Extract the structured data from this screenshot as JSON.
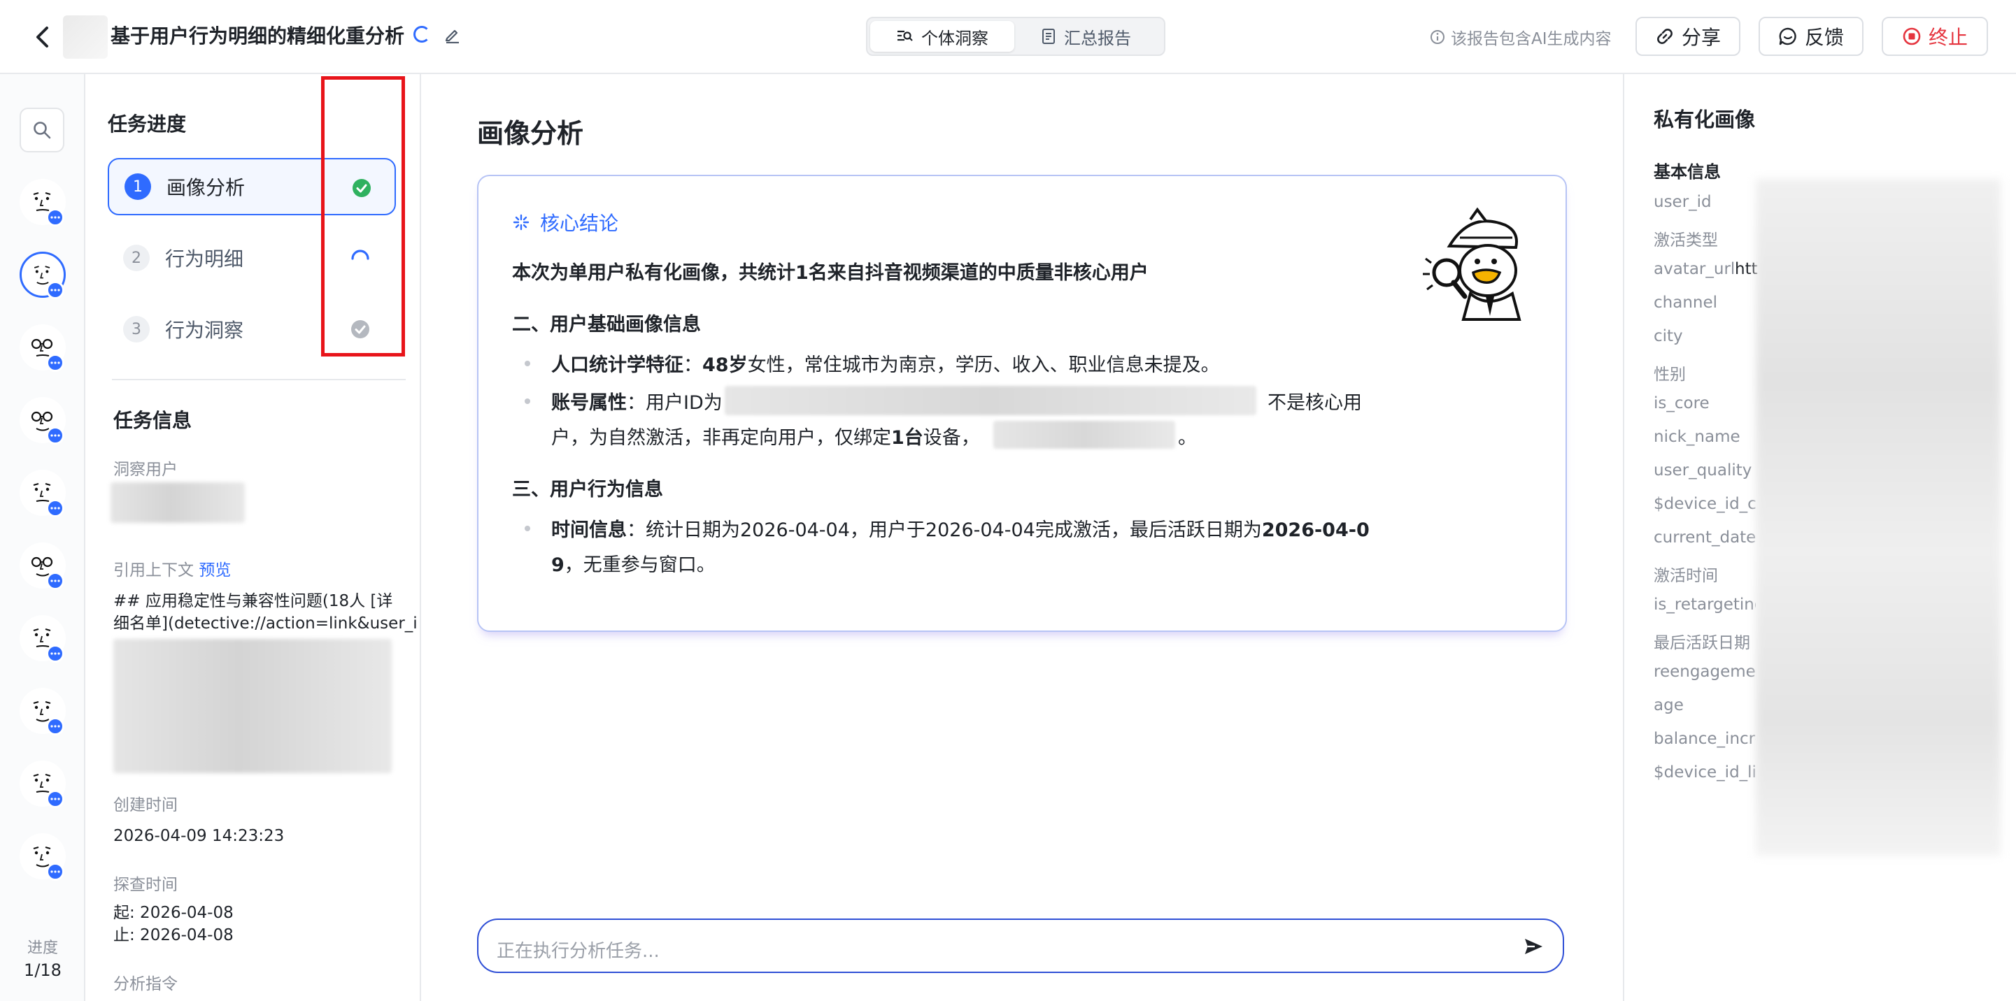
{
  "header": {
    "title": "基于用户行为明细的精细化重分析",
    "tabs": [
      {
        "label": "个体洞察",
        "icon": "insight-icon",
        "active": true
      },
      {
        "label": "汇总报告",
        "icon": "document-icon",
        "active": false
      }
    ],
    "ai_notice": "该报告包含AI生成内容",
    "share_label": "分享",
    "feedback_label": "反馈",
    "stop_label": "终止"
  },
  "rail": {
    "avatar_count": 10,
    "selected_index": 1,
    "progress_label": "进度",
    "progress_value": "1/18"
  },
  "task_panel": {
    "progress_heading": "任务进度",
    "steps": [
      {
        "num": "1",
        "label": "画像分析",
        "status": "completed"
      },
      {
        "num": "2",
        "label": "行为明细",
        "status": "in-progress"
      },
      {
        "num": "3",
        "label": "行为洞察",
        "status": "pending"
      }
    ],
    "info_heading": "任务信息",
    "insight_user_label": "洞察用户",
    "context_label": "引用上下文",
    "context_preview_link": "预览",
    "context_text_1": "## 应用稳定性与兼容性问题(18人 [详",
    "context_text_2": "细名单](detective://action=link&user_i",
    "created_label": "创建时间",
    "created_value": "2026-04-09 14:23:23",
    "explore_label": "探查时间",
    "explore_start": "起: 2026-04-08",
    "explore_end": "止: 2026-04-08",
    "instruction_label": "分析指令"
  },
  "main": {
    "title": "画像分析",
    "card_heading": "核心结论",
    "summary": "本次为单用户私有化画像，共统计1名来自抖音视频渠道的中质量非核心用户",
    "section2_title": "二、用户基础画像信息",
    "demographics_label": "人口统计学特征",
    "demographics_sep": "：",
    "demographics_age": "48岁",
    "demographics_rest": "女性，常住城市为南京，学历、收入、职业信息未提及。",
    "account_label": "账号属性",
    "account_prefix": "：用户ID为",
    "account_suffix": "不是核心用",
    "account_line2_a": "户，为自然激活，非再定向用户，仅绑定",
    "account_devices": "1台",
    "account_line2_b": "设备，",
    "account_end": "。",
    "section3_title": "三、用户行为信息",
    "time_label": "时间信息",
    "time_text": "：统计日期为2026-04-04，用户于2026-04-04完成激活，最后活跃日期为",
    "time_bold_a": "2026-04-0",
    "time_bold_b": "9",
    "time_tail": "，无重参与窗口。",
    "input_placeholder": "正在执行分析任务..."
  },
  "profile": {
    "title": "私有化画像",
    "subtitle": "基本信息",
    "attributes": [
      "user_id",
      "激活类型",
      "avatar_url",
      "channel",
      "city",
      "性别",
      "is_core",
      "nick_name",
      "user_quality",
      "$device_id_co",
      "current_date",
      "激活时间",
      "is_retargeting",
      "最后活跃日期",
      "reengagement",
      "age",
      "balance_incre",
      "$device_id_lis"
    ],
    "avatar_url_value": "htt"
  }
}
